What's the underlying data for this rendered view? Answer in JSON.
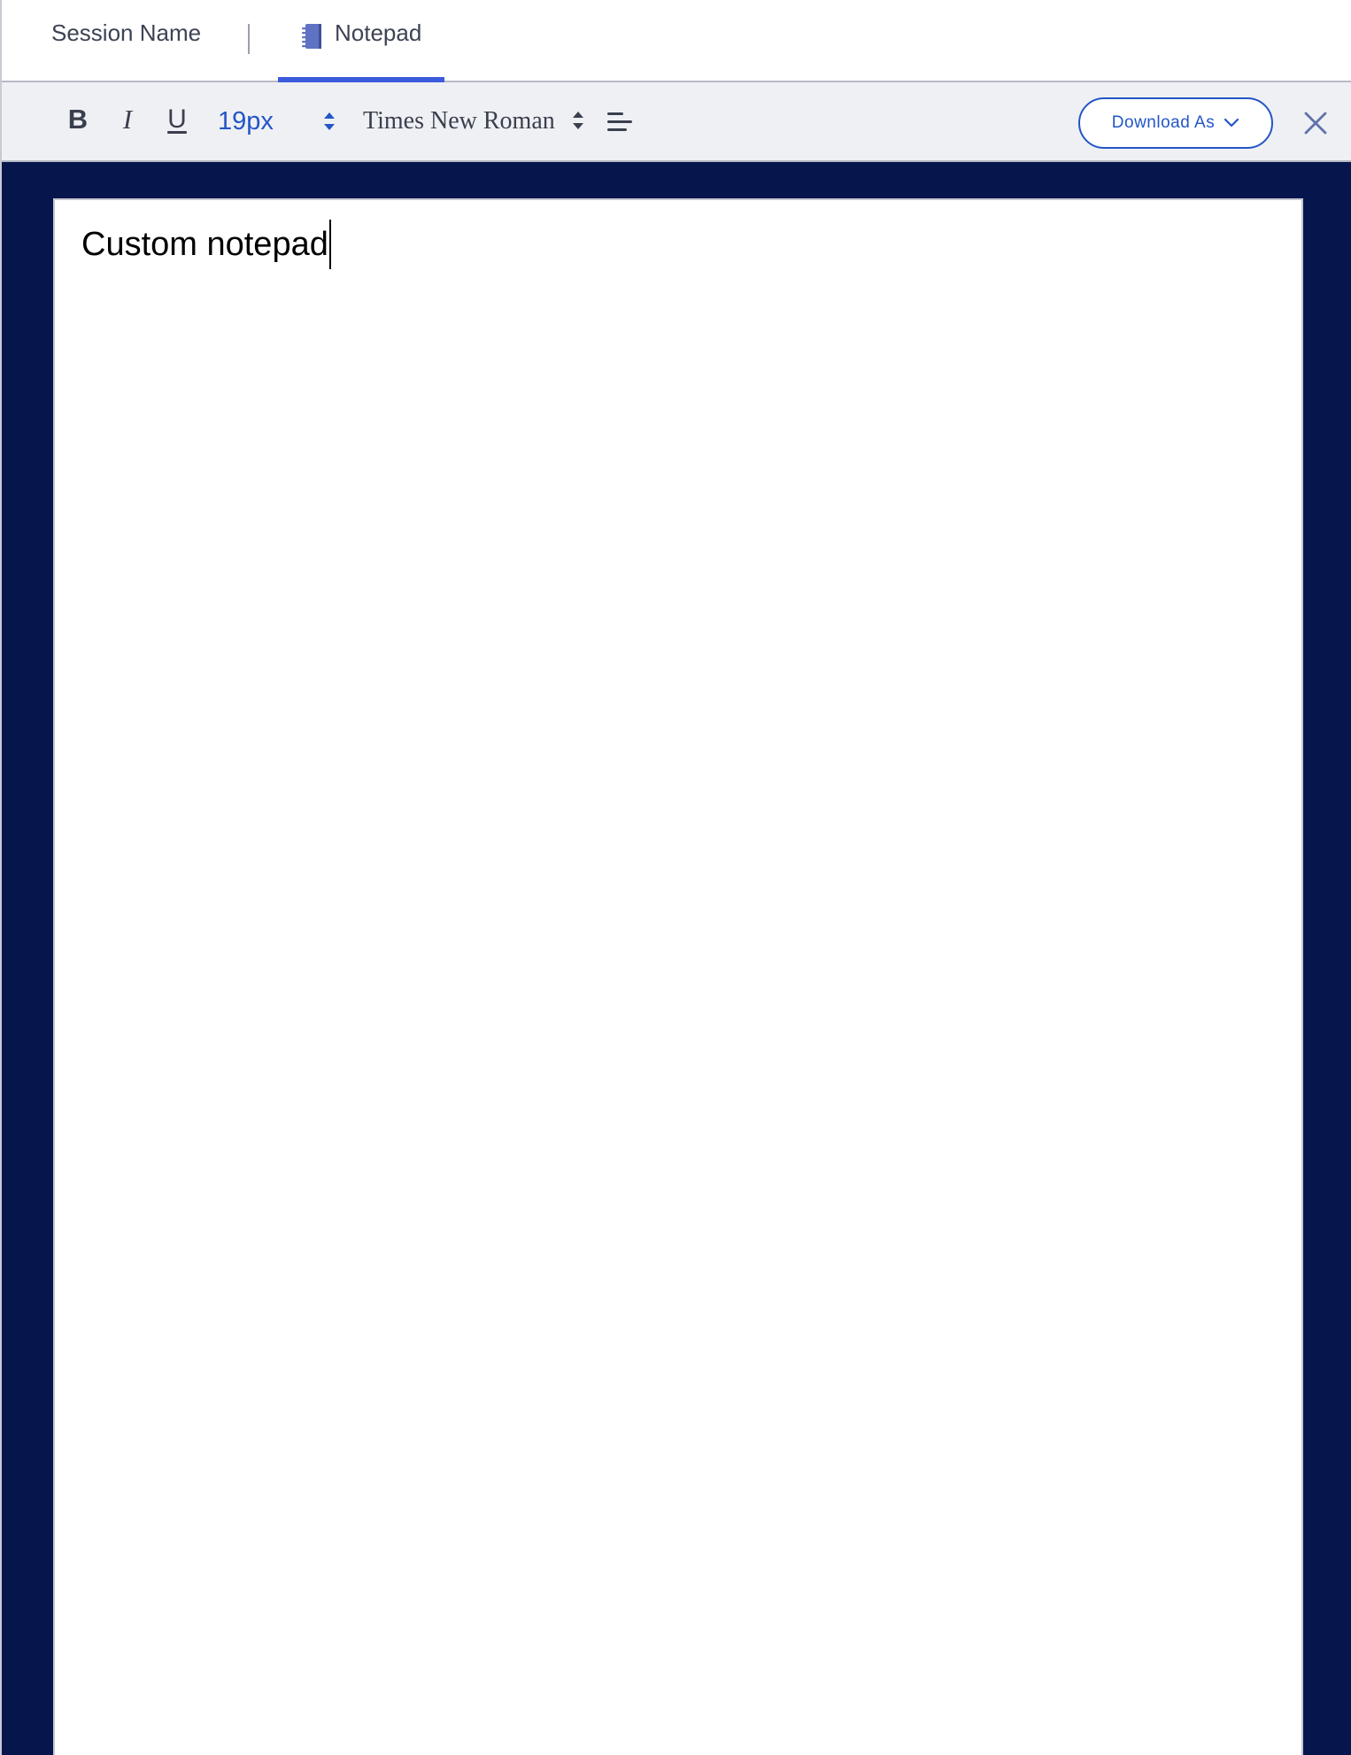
{
  "tabs": {
    "session_label": "Session Name",
    "notepad_label": "Notepad"
  },
  "toolbar": {
    "bold_label": "B",
    "italic_label": "I",
    "underline_label": "U",
    "font_size": "19px",
    "font_family": "Times New Roman",
    "download_label": "Download As"
  },
  "editor": {
    "content": "Custom notepad"
  },
  "icons": {
    "notepad": "notebook-icon",
    "size_spinner": "up-down-arrows-icon",
    "family_spinner": "up-down-arrows-icon",
    "align": "align-left-icon",
    "download_chevron": "chevron-down-icon",
    "close": "close-icon"
  },
  "colors": {
    "accent": "#3b5bdb",
    "link_blue": "#2356c6",
    "editor_background": "#06164d",
    "toolbar_background": "#eff0f4"
  }
}
